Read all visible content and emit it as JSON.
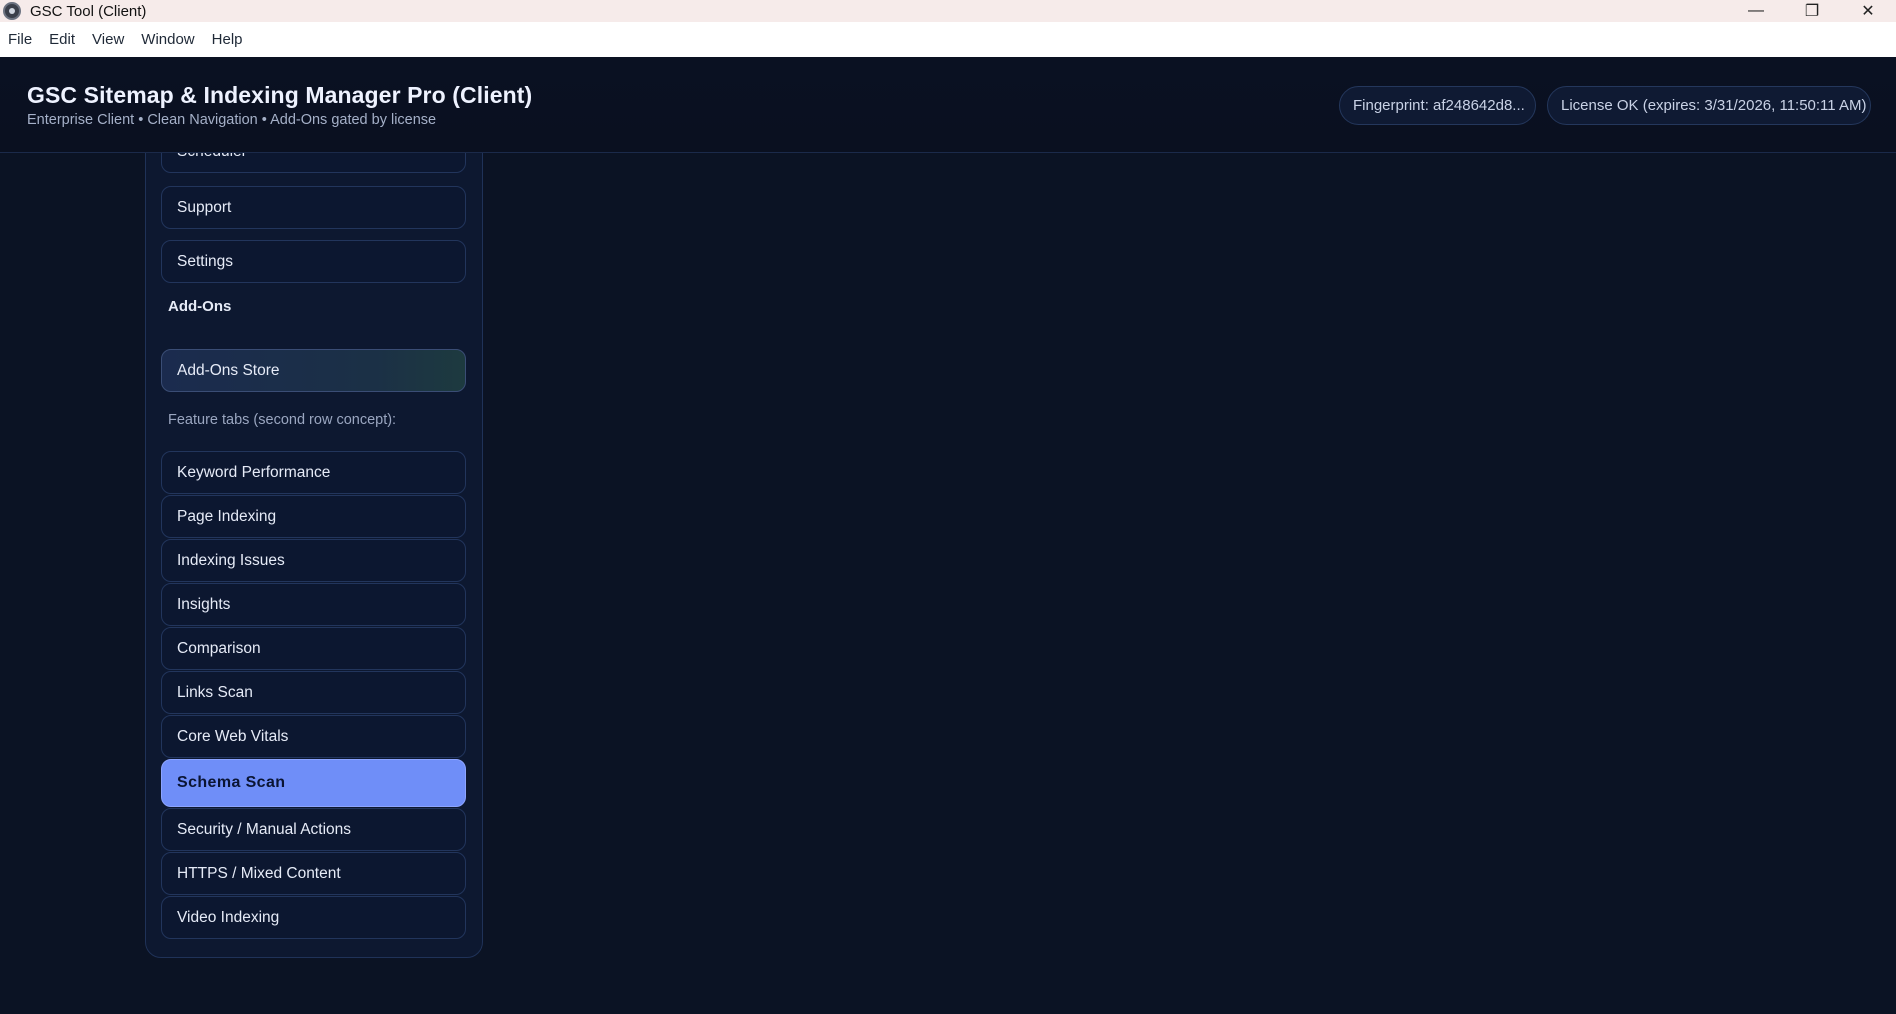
{
  "window": {
    "title": "GSC Tool (Client)",
    "controls": {
      "minimize": "—",
      "maximize": "❐",
      "close": "✕"
    }
  },
  "menu": {
    "items": [
      "File",
      "Edit",
      "View",
      "Window",
      "Help"
    ]
  },
  "header": {
    "title": "GSC Sitemap & Indexing Manager Pro (Client)",
    "subtitle": "Enterprise Client • Clean Navigation • Add-Ons gated by license",
    "fingerprint": "Fingerprint: af248642d8...",
    "license": "License OK (expires: 3/31/2026, 11:50:11 AM)"
  },
  "sidebar": {
    "top_items": [
      "Scheduler",
      "Support",
      "Settings"
    ],
    "addons_heading": "Add-Ons",
    "addons_store": "Add-Ons Store",
    "feature_hint": "Feature tabs (second row concept):",
    "feature_tabs": [
      "Keyword Performance",
      "Page Indexing",
      "Indexing Issues",
      "Insights",
      "Comparison",
      "Links Scan",
      "Core Web Vitals",
      "Schema Scan",
      "Security / Manual Actions",
      "HTTPS / Mixed Content",
      "Video Indexing"
    ],
    "active_tab": "Schema Scan"
  },
  "colors": {
    "background": "#0b1324",
    "accent": "#6f8ef8",
    "panel": "#0d1830"
  }
}
